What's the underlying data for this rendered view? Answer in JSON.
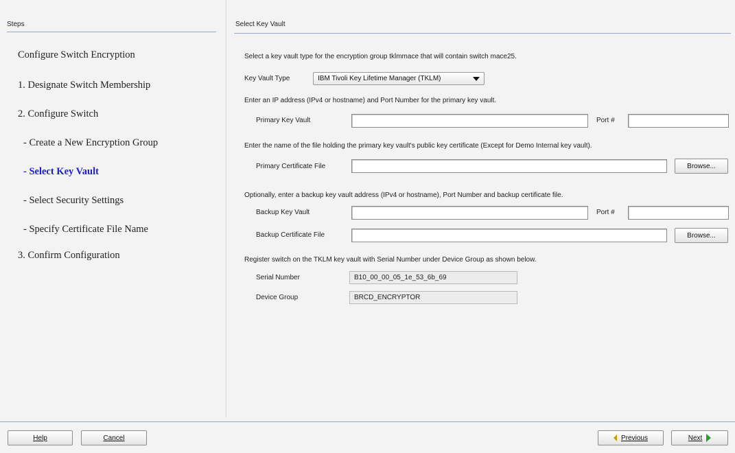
{
  "steps": {
    "header": "Steps",
    "items": [
      {
        "label": "Configure Switch Encryption"
      },
      {
        "label": "1. Designate Switch Membership"
      },
      {
        "label": "2. Configure Switch"
      },
      {
        "label": "- Create a New Encryption Group"
      },
      {
        "label": "- Select Key Vault"
      },
      {
        "label": "- Select Security Settings"
      },
      {
        "label": "- Specify Certificate File Name"
      },
      {
        "label": "3. Confirm Configuration"
      }
    ],
    "active_index": 4
  },
  "panel": {
    "title": "Select Key Vault",
    "intro": "Select a key vault type for the encryption group tklmmace that will contain switch mace25.",
    "key_vault_type_label": "Key Vault Type",
    "key_vault_type_value": "IBM Tivoli Key Lifetime Manager (TKLM)",
    "primary_instruction": "Enter an IP address (IPv4 or hostname) and Port Number for the primary key vault.",
    "primary_key_vault_label": "Primary Key Vault",
    "primary_key_vault_value": "",
    "primary_port_label": "Port #",
    "primary_port_value": "",
    "cert_instruction": "Enter the name of the file holding the primary key vault's public key certificate (Except for Demo Internal key vault).",
    "primary_cert_label": "Primary Certificate File",
    "primary_cert_value": "",
    "browse_label": "Browse...",
    "backup_instruction": "Optionally, enter a backup key vault address (IPv4 or hostname), Port Number and backup certificate file.",
    "backup_key_vault_label": "Backup Key Vault",
    "backup_key_vault_value": "",
    "backup_port_label": "Port #",
    "backup_port_value": "",
    "backup_cert_label": "Backup Certificate File",
    "backup_cert_value": "",
    "register_instruction": "Register switch on the TKLM key vault with Serial Number under Device Group as shown below.",
    "serial_label": "Serial Number",
    "serial_value": "B10_00_00_05_1e_53_6b_69",
    "device_group_label": "Device Group",
    "device_group_value": "BRCD_ENCRYPTOR"
  },
  "footer": {
    "help_label": "Help",
    "cancel_label": "Cancel",
    "previous_label": "Previous",
    "next_label": "Next"
  },
  "colors": {
    "active_step": "#1c1cd0",
    "rule": "#9aa8c4",
    "panel_bg": "#f3f3f3",
    "previous_arrow": "#c8a000",
    "next_arrow": "#2aa02a"
  },
  "icons": {
    "dropdown": "chevron-down-icon",
    "previous": "arrow-left-icon",
    "next": "arrow-right-icon"
  }
}
